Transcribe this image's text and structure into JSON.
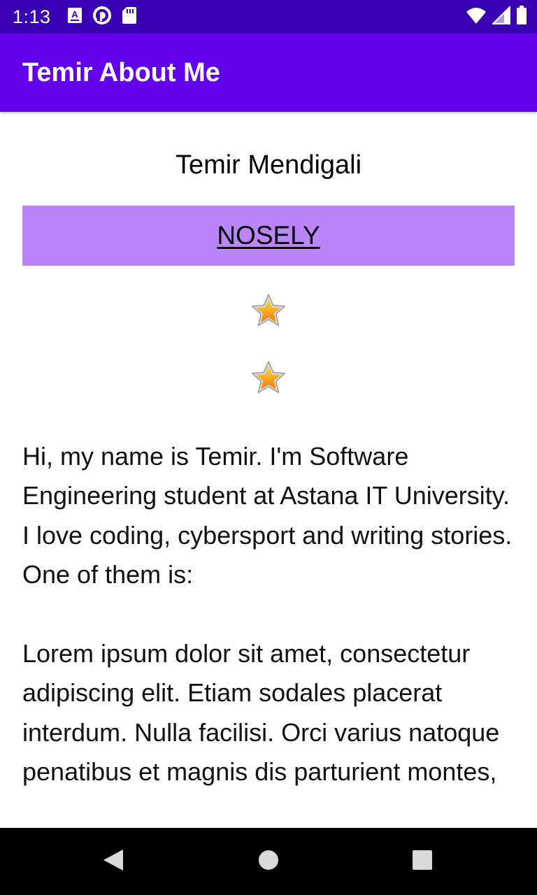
{
  "status_bar": {
    "time": "1:13",
    "background": "#3700b3",
    "icons_left": [
      "text-a-icon",
      "pocket-casts-icon",
      "sd-card-icon"
    ],
    "icons_right": [
      "wifi-icon",
      "cellular-signal-icon",
      "battery-icon"
    ]
  },
  "app_bar": {
    "title": "Temir About Me",
    "background": "#6200ee"
  },
  "profile": {
    "name": "Temir Mendigali",
    "nickname": "NOSELY",
    "nickname_background": "#bb86fc",
    "stars": [
      "star-icon",
      "star-icon"
    ]
  },
  "bio": {
    "text": "Hi, my name is Temir. I'm Software Engineering student at Astana IT University. I love coding, cybersport and writing stories. One of them is:\n\nLorem ipsum dolor sit amet, consectetur adipiscing elit. Etiam sodales placerat interdum. Nulla facilisi. Orci varius natoque penatibus et magnis dis parturient montes,"
  },
  "nav_bar": {
    "buttons": [
      "back-icon",
      "home-icon",
      "recents-icon"
    ]
  }
}
